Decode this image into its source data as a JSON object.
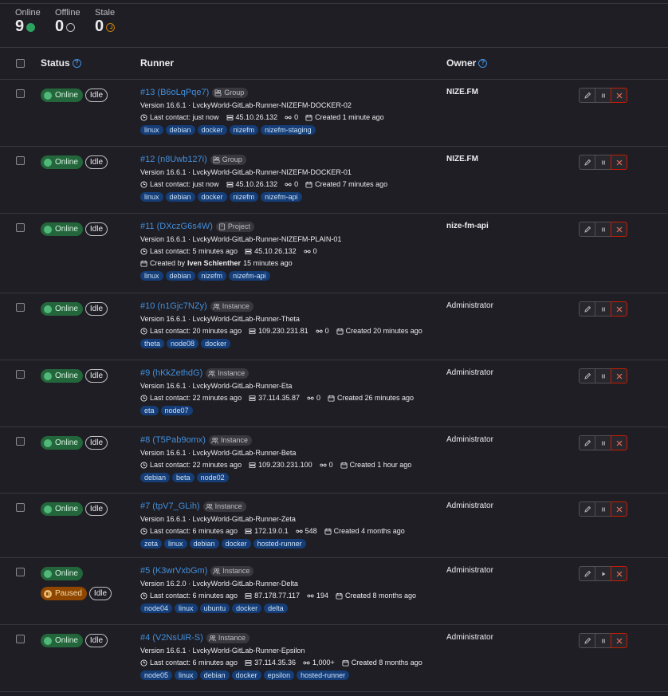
{
  "stats": [
    {
      "label": "Online",
      "count": "9",
      "icon": "online-dot-icon"
    },
    {
      "label": "Offline",
      "count": "0",
      "icon": "offline-ring-icon"
    },
    {
      "label": "Stale",
      "count": "0",
      "icon": "stale-clock-icon"
    }
  ],
  "table": {
    "status_header": "Status",
    "runner_header": "Runner",
    "owner_header": "Owner"
  },
  "colors": {
    "online": "#2da160",
    "link": "#428fdc",
    "tag_bg": "#153d77",
    "danger": "#c91c00",
    "paused": "#8f4700"
  },
  "runners": [
    {
      "title": "#13 (B6oLqPqe7)",
      "type": "Group",
      "type_icon": "group-icon",
      "status": [
        "Online",
        "Idle"
      ],
      "paused": "",
      "version": "Version 16.6.1 · LvckyWorld-GitLab-Runner-NIZEFM-DOCKER-02",
      "contact": "Last contact: just now",
      "ip": "45.10.26.132",
      "jobs": "0",
      "created": "Created 1 minute ago",
      "created_by": "",
      "created_by_suffix": "",
      "tags": [
        "linux",
        "debian",
        "docker",
        "nizefm",
        "nizefm-staging"
      ],
      "owner": "NIZE.FM",
      "owner_bold": true,
      "second_action": "pause"
    },
    {
      "title": "#12 (n8Uwb127i)",
      "type": "Group",
      "type_icon": "group-icon",
      "status": [
        "Online",
        "Idle"
      ],
      "paused": "",
      "version": "Version 16.6.1 · LvckyWorld-GitLab-Runner-NIZEFM-DOCKER-01",
      "contact": "Last contact: just now",
      "ip": "45.10.26.132",
      "jobs": "0",
      "created": "Created 7 minutes ago",
      "created_by": "",
      "created_by_suffix": "",
      "tags": [
        "linux",
        "debian",
        "docker",
        "nizefm",
        "nizefm-api"
      ],
      "owner": "NIZE.FM",
      "owner_bold": true,
      "second_action": "pause"
    },
    {
      "title": "#11 (DXczG6s4W)",
      "type": "Project",
      "type_icon": "project-icon",
      "status": [
        "Online",
        "Idle"
      ],
      "paused": "",
      "version": "Version 16.6.1 · LvckyWorld-GitLab-Runner-NIZEFM-PLAIN-01",
      "contact": "Last contact: 5 minutes ago",
      "ip": "45.10.26.132",
      "jobs": "0",
      "created": "",
      "created_by": "Iven Schlenther",
      "created_by_suffix": "15 minutes ago",
      "created_by_prefix": "Created by",
      "tags": [
        "linux",
        "debian",
        "nizefm",
        "nizefm-api"
      ],
      "owner": "nize-fm-api",
      "owner_bold": true,
      "second_action": "pause"
    },
    {
      "title": "#10 (n1Gjc7NZy)",
      "type": "Instance",
      "type_icon": "instance-icon",
      "status": [
        "Online",
        "Idle"
      ],
      "paused": "",
      "version": "Version 16.6.1 · LvckyWorld-GitLab-Runner-Theta",
      "contact": "Last contact: 20 minutes ago",
      "ip": "109.230.231.81",
      "jobs": "0",
      "created": "Created 20 minutes ago",
      "created_by": "",
      "created_by_suffix": "",
      "tags": [
        "theta",
        "node08",
        "docker"
      ],
      "owner": "Administrator",
      "owner_bold": false,
      "second_action": "pause"
    },
    {
      "title": "#9 (hKkZethdG)",
      "type": "Instance",
      "type_icon": "instance-icon",
      "status": [
        "Online",
        "Idle"
      ],
      "paused": "",
      "version": "Version 16.6.1 · LvckyWorld-GitLab-Runner-Eta",
      "contact": "Last contact: 22 minutes ago",
      "ip": "37.114.35.87",
      "jobs": "0",
      "created": "Created 26 minutes ago",
      "created_by": "",
      "created_by_suffix": "",
      "tags": [
        "eta",
        "node07"
      ],
      "owner": "Administrator",
      "owner_bold": false,
      "second_action": "pause"
    },
    {
      "title": "#8 (T5Pab9omx)",
      "type": "Instance",
      "type_icon": "instance-icon",
      "status": [
        "Online",
        "Idle"
      ],
      "paused": "",
      "version": "Version 16.6.1 · LvckyWorld-GitLab-Runner-Beta",
      "contact": "Last contact: 22 minutes ago",
      "ip": "109.230.231.100",
      "jobs": "0",
      "created": "Created 1 hour ago",
      "created_by": "",
      "created_by_suffix": "",
      "tags": [
        "debian",
        "beta",
        "node02"
      ],
      "owner": "Administrator",
      "owner_bold": false,
      "second_action": "pause"
    },
    {
      "title": "#7 (tpV7_GLih)",
      "type": "Instance",
      "type_icon": "instance-icon",
      "status": [
        "Online",
        "Idle"
      ],
      "paused": "",
      "version": "Version 16.6.1 · LvckyWorld-GitLab-Runner-Zeta",
      "contact": "Last contact: 6 minutes ago",
      "ip": "172.19.0.1",
      "jobs": "548",
      "created": "Created 4 months ago",
      "created_by": "",
      "created_by_suffix": "",
      "tags": [
        "zeta",
        "linux",
        "debian",
        "docker",
        "hosted-runner"
      ],
      "owner": "Administrator",
      "owner_bold": false,
      "second_action": "pause"
    },
    {
      "title": "#5 (K3wrVxbGm)",
      "type": "Instance",
      "type_icon": "instance-icon",
      "status": [
        "Online"
      ],
      "paused": "Paused",
      "version": "Version 16.2.0 · LvckyWorld-GitLab-Runner-Delta",
      "contact": "Last contact: 6 minutes ago",
      "ip": "87.178.77.117",
      "jobs": "194",
      "created": "Created 8 months ago",
      "created_by": "",
      "created_by_suffix": "",
      "tags": [
        "node04",
        "linux",
        "ubuntu",
        "docker",
        "delta"
      ],
      "owner": "Administrator",
      "owner_bold": false,
      "second_action": "resume"
    },
    {
      "title": "#4 (V2NsUiR-S)",
      "type": "Instance",
      "type_icon": "instance-icon",
      "status": [
        "Online",
        "Idle"
      ],
      "paused": "",
      "version": "Version 16.6.1 · LvckyWorld-GitLab-Runner-Epsilon",
      "contact": "Last contact: 6 minutes ago",
      "ip": "37.114.35.36",
      "jobs": "1,000+",
      "created": "Created 8 months ago",
      "created_by": "",
      "created_by_suffix": "",
      "tags": [
        "node05",
        "linux",
        "debian",
        "docker",
        "epsilon",
        "hosted-runner"
      ],
      "owner": "Administrator",
      "owner_bold": false,
      "second_action": "pause"
    }
  ]
}
